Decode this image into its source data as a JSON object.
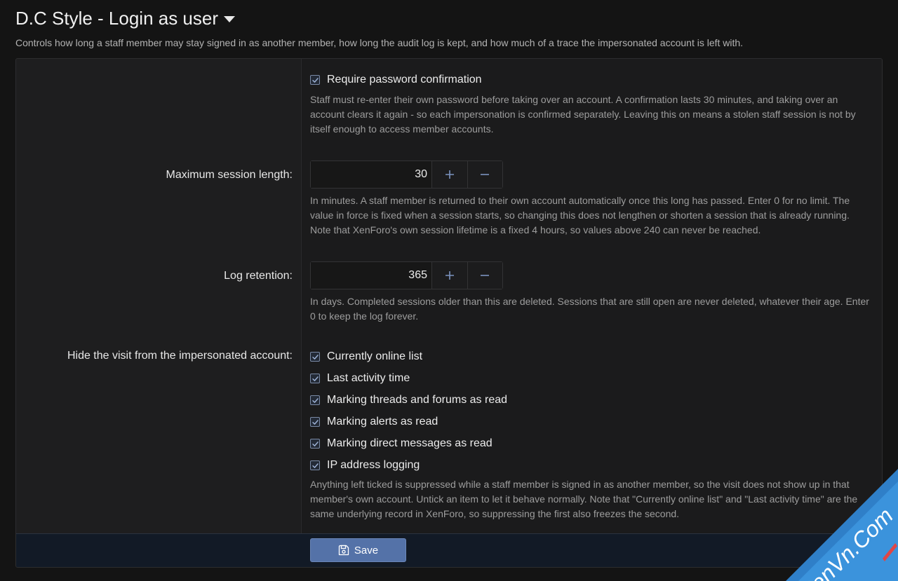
{
  "header": {
    "title": "D.C Style - Login as user",
    "description": "Controls how long a staff member may stay signed in as another member, how long the audit log is kept, and how much of a trace the impersonated account is left with."
  },
  "require_password": {
    "checked": true,
    "label": "Require password confirmation",
    "hint": "Staff must re-enter their own password before taking over an account. A confirmation lasts 30 minutes, and taking over an account clears it again - so each impersonation is confirmed separately. Leaving this on means a stolen staff session is not by itself enough to access member accounts."
  },
  "max_session": {
    "label": "Maximum session length:",
    "value": "30",
    "hint": "In minutes. A staff member is returned to their own account automatically once this long has passed. Enter 0 for no limit. The value in force is fixed when a session starts, so changing this does not lengthen or shorten a session that is already running. Note that XenForo's own session lifetime is a fixed 4 hours, so values above 240 can never be reached."
  },
  "log_retention": {
    "label": "Log retention:",
    "value": "365",
    "hint": "In days. Completed sessions older than this are deleted. Sessions that are still open are never deleted, whatever their age. Enter 0 to keep the log forever."
  },
  "hide_visit": {
    "label": "Hide the visit from the impersonated account:",
    "options": [
      {
        "label": "Currently online list",
        "checked": true
      },
      {
        "label": "Last activity time",
        "checked": true
      },
      {
        "label": "Marking threads and forums as read",
        "checked": true
      },
      {
        "label": "Marking alerts as read",
        "checked": true
      },
      {
        "label": "Marking direct messages as read",
        "checked": true
      },
      {
        "label": "IP address logging",
        "checked": true
      }
    ],
    "hint": "Anything left ticked is suppressed while a staff member is signed in as another member, so the visit does not show up in that member's own account. Untick an item to let it behave normally. Note that \"Currently online list\" and \"Last activity time\" are the same underlying record in XenForo, so suppressing the first also freezes the second."
  },
  "footer": {
    "save_label": "Save"
  },
  "watermark": {
    "text": "XenVn.Com"
  },
  "colors": {
    "accent": "#5472a8",
    "background": "#141414"
  }
}
